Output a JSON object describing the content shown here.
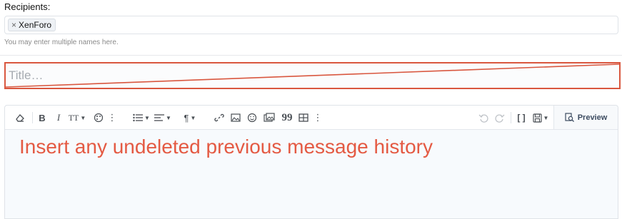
{
  "recipients": {
    "label": "Recipients:",
    "tokens": [
      {
        "name": "XenForo",
        "remove_symbol": "×"
      }
    ],
    "hint": "You may enter multiple names here."
  },
  "title_field": {
    "placeholder": "Title…"
  },
  "editor": {
    "toolbar": {
      "paragraph_icon": "¶",
      "text_size_icon": "TT",
      "bold_label": "B",
      "italic_label": "I",
      "more_icon": "⋮",
      "quote_icon": "99",
      "code_icon": "[ ]",
      "preview_label": "Preview"
    },
    "annotation": "Insert any undeleted previous message history"
  },
  "colors": {
    "annotation_red": "#e45a43",
    "title_border": "#d9573f"
  }
}
